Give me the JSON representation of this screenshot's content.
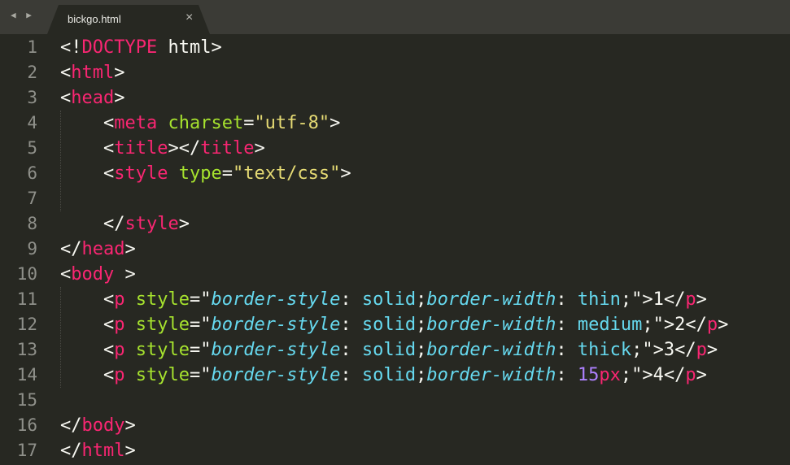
{
  "tab": {
    "title": "bickgo.html",
    "close": "×",
    "nav": "◀ ▶"
  },
  "line_numbers": [
    "1",
    "2",
    "3",
    "4",
    "5",
    "6",
    "7",
    "8",
    "9",
    "10",
    "11",
    "12",
    "13",
    "14",
    "15",
    "16",
    "17"
  ],
  "code": {
    "l1": {
      "open": "<!",
      "tag": "DOCTYPE",
      "rest": " html>"
    },
    "l2": {
      "open": "<",
      "tag": "html",
      "close": ">"
    },
    "l3": {
      "open": "<",
      "tag": "head",
      "close": ">"
    },
    "l4": {
      "indent": "    ",
      "open": "<",
      "tag": "meta",
      "sp": " ",
      "attr": "charset",
      "eq": "=",
      "val": "\"utf-8\"",
      "close": ">"
    },
    "l5": {
      "indent": "    ",
      "open": "<",
      "tag": "title",
      "mid": "></",
      "tag2": "title",
      "close": ">"
    },
    "l6": {
      "indent": "    ",
      "open": "<",
      "tag": "style",
      "sp": " ",
      "attr": "type",
      "eq": "=",
      "val": "\"text/css\"",
      "close": ">"
    },
    "l8": {
      "indent": "    ",
      "open": "</",
      "tag": "style",
      "close": ">"
    },
    "l9": {
      "open": "</",
      "tag": "head",
      "close": ">"
    },
    "l10": {
      "open": "<",
      "tag": "body",
      "close": " >"
    },
    "p_lines": [
      {
        "width_value": "thin",
        "width_unit": "",
        "content": "1"
      },
      {
        "width_value": "medium",
        "width_unit": "",
        "content": "2"
      },
      {
        "width_value": "thick",
        "width_unit": "",
        "content": "3"
      },
      {
        "width_value": "15",
        "width_unit": "px",
        "content": "4"
      }
    ],
    "p_tokens": {
      "indent": "    ",
      "lt": "<",
      "tag": "p",
      "sp": " ",
      "attr": "style",
      "eqq": "=\"",
      "prop1": "border-style",
      "colon": ": ",
      "val1": "solid",
      "semi": ";",
      "prop2": "border-width",
      "endq": ";\">",
      "closeopen": "</",
      "gt": ">"
    },
    "l16": {
      "open": "</",
      "tag": "body",
      "close": ">"
    },
    "l17": {
      "open": "</",
      "tag": "html",
      "close": ">"
    }
  }
}
